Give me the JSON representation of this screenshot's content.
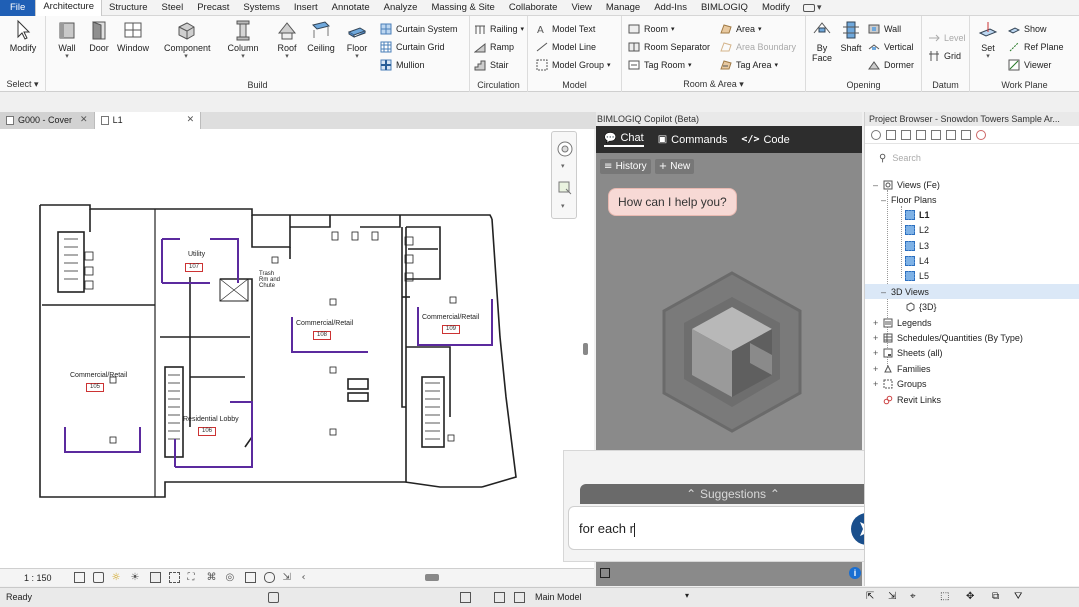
{
  "menubar": {
    "file": "File",
    "tabs": [
      "Architecture",
      "Structure",
      "Steel",
      "Precast",
      "Systems",
      "Insert",
      "Annotate",
      "Analyze",
      "Massing & Site",
      "Collaborate",
      "View",
      "Manage",
      "Add-Ins",
      "BIMLOGIQ",
      "Modify"
    ],
    "extra": "▾"
  },
  "ribbon": {
    "select": {
      "modify": "Modify",
      "title": "Select ▾"
    },
    "build": {
      "buttons": [
        "Wall",
        "Door",
        "Window",
        "Component",
        "Column",
        "Roof",
        "Ceiling",
        "Floor"
      ],
      "small": [
        "Curtain System",
        "Curtain Grid",
        "Mullion"
      ],
      "title": "Build"
    },
    "circulation": {
      "small": [
        "Railing",
        "Ramp",
        "Stair"
      ],
      "title": "Circulation"
    },
    "model": {
      "small": [
        "Model Text",
        "Model Line",
        "Model Group"
      ],
      "title": "Model"
    },
    "room_area": {
      "small": [
        "Room",
        "Room Separator",
        "Tag Room",
        "Area",
        "Area Boundary",
        "Tag Area"
      ],
      "title": "Room & Area ▾"
    },
    "opening": {
      "buttons": [
        "By Face",
        "Shaft"
      ],
      "small": [
        "Wall",
        "Vertical",
        "Dormer"
      ],
      "title": "Opening"
    },
    "datum": {
      "small": [
        "Level",
        "Grid"
      ],
      "title": "Datum"
    },
    "workplane": {
      "set": "Set",
      "small": [
        "Show",
        "Ref Plane",
        "Viewer"
      ],
      "title": "Work Plane"
    }
  },
  "viewtabs": [
    {
      "label": "G000 - Cover"
    },
    {
      "label": "L1"
    }
  ],
  "canvas": {
    "rooms": [
      {
        "name": "Utility",
        "number": "107"
      },
      {
        "name": "Commercial/Retail",
        "number": "108"
      },
      {
        "name": "Commercial/Retail",
        "number": "109"
      },
      {
        "name": "Commercial/Retail",
        "number": "105"
      },
      {
        "name": "Residential Lobby",
        "number": "106"
      }
    ],
    "trash_label": "Trash Rm and Chute"
  },
  "viewcontrol": {
    "scale": "1 : 150"
  },
  "statusbar": {
    "ready": "Ready",
    "model": "Main Model"
  },
  "copilot": {
    "title": "BIMLOGIQ Copilot (Beta)",
    "tabs": [
      "Chat",
      "Commands",
      "Code"
    ],
    "history": "History",
    "new": "New",
    "greeting": "How can I help you?",
    "suggestions": "Suggestions",
    "input_value": "for each r"
  },
  "browser": {
    "title": "Project Browser - Snowdon Towers Sample Ar...",
    "search_placeholder": "Search",
    "tree": [
      "Views (Fe)",
      "Floor Plans",
      "L1",
      "L2",
      "L3",
      "L4",
      "L5",
      "3D Views",
      "{3D}",
      "Legends",
      "Schedules/Quantities (By Type)",
      "Sheets (all)",
      "Families",
      "Groups",
      "Revit Links"
    ]
  },
  "colors": {
    "accent": "#1f5fb5",
    "room_border": "#5b2a9e",
    "copilot_bg": "#8a8a8a",
    "send": "#1a4f8c"
  }
}
